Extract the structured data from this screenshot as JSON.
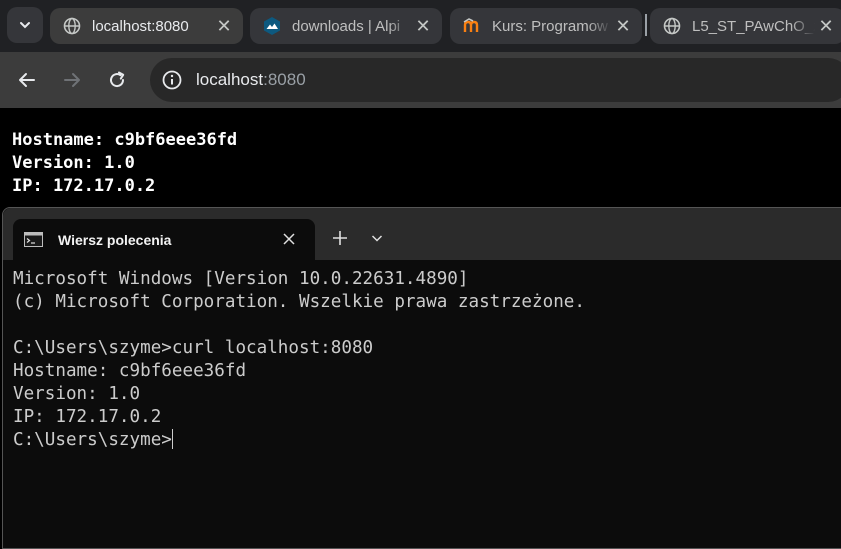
{
  "browser": {
    "tabs": [
      {
        "title": "localhost:8080",
        "favicon": "globe-icon",
        "active": true
      },
      {
        "title": "downloads | Alpi",
        "favicon": "alpine-icon",
        "active": false
      },
      {
        "title": "Kurs: Programow",
        "favicon": "moodle-icon",
        "active": false
      },
      {
        "title": "L5_ST_PAwChO_z",
        "favicon": "globe-icon",
        "active": false
      }
    ],
    "address": {
      "host": "localhost",
      "port": ":8080"
    },
    "colors": {
      "tabstrip": "#202124",
      "toolbar": "#3c3c3c",
      "omnibox": "#282828"
    }
  },
  "page": {
    "lines": [
      "Hostname: c9bf6eee36fd",
      "Version: 1.0",
      "IP: 172.17.0.2"
    ]
  },
  "terminal": {
    "tab_title": "Wiersz polecenia",
    "lines": [
      "Microsoft Windows [Version 10.0.22631.4890]",
      "(c) Microsoft Corporation. Wszelkie prawa zastrzeżone.",
      "",
      "C:\\Users\\szyme>curl localhost:8080",
      "Hostname: c9bf6eee36fd",
      "Version: 1.0",
      "IP: 172.17.0.2"
    ],
    "prompt": "C:\\Users\\szyme>",
    "colors": {
      "background": "#0c0c0c",
      "text": "#cccccc"
    }
  }
}
